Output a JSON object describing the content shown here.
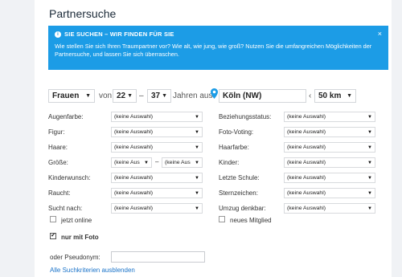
{
  "title": "Partnersuche",
  "info": {
    "heading": "SIE SUCHEN – WIR FINDEN FÜR SIE",
    "text": "Wie stellen Sie sich Ihren Traumpartner vor? Wie alt, wie jung, wie groß? Nutzen Sie die umfangreichen Möglichkeiten der Partnersuche, und lassen Sie sich überraschen.",
    "close": "×"
  },
  "search": {
    "gender": "Frauen",
    "von": "von",
    "age_from": "22",
    "dash": "–",
    "age_to": "37",
    "jahren_aus": "Jahren aus",
    "location": "Köln (NW)",
    "radius_prefix": "‹",
    "radius": "50 km"
  },
  "fields_left": [
    {
      "label": "Augenfarbe:",
      "value": "(keine Auswahl)"
    },
    {
      "label": "Figur:",
      "value": "(keine Auswahl)"
    },
    {
      "label": "Haare:",
      "value": "(keine Auswahl)"
    },
    {
      "label": "Größe:",
      "value_from": "(keine Aus",
      "dash": "–",
      "value_to": "(keine Aus"
    },
    {
      "label": "Kinderwunsch:",
      "value": "(keine Auswahl)"
    },
    {
      "label": "Raucht:",
      "value": "(keine Auswahl)"
    },
    {
      "label": "Sucht nach:",
      "value": "(keine Auswahl)"
    }
  ],
  "fields_right": [
    {
      "label": "Beziehungsstatus:",
      "value": "(keine Auswahl)"
    },
    {
      "label": "Foto-Voting:",
      "value": "(keine Auswahl)"
    },
    {
      "label": "Haarfarbe:",
      "value": "(keine Auswahl)"
    },
    {
      "label": "Kinder:",
      "value": "(keine Auswahl)"
    },
    {
      "label": "Letzte Schule:",
      "value": "(keine Auswahl)"
    },
    {
      "label": "Sternzeichen:",
      "value": "(keine Auswahl)"
    },
    {
      "label": "Umzug denkbar:",
      "value": "(keine Auswahl)"
    }
  ],
  "checkboxes": {
    "jetzt_online": "jetzt online",
    "neues_mitglied": "neues Mitglied",
    "nur_mit_foto": "nur mit Foto",
    "nur_mit_foto_checked": true
  },
  "pseudonym_label": "oder Pseudonym:",
  "pseudonym_value": "",
  "hide_link": "Alle Suchkriterien ausblenden",
  "arrow": "▼",
  "check": "✔",
  "colors": {
    "info_bg": "#1c9ce6",
    "link": "#1a73c9",
    "pin": "#1c9ce6"
  }
}
